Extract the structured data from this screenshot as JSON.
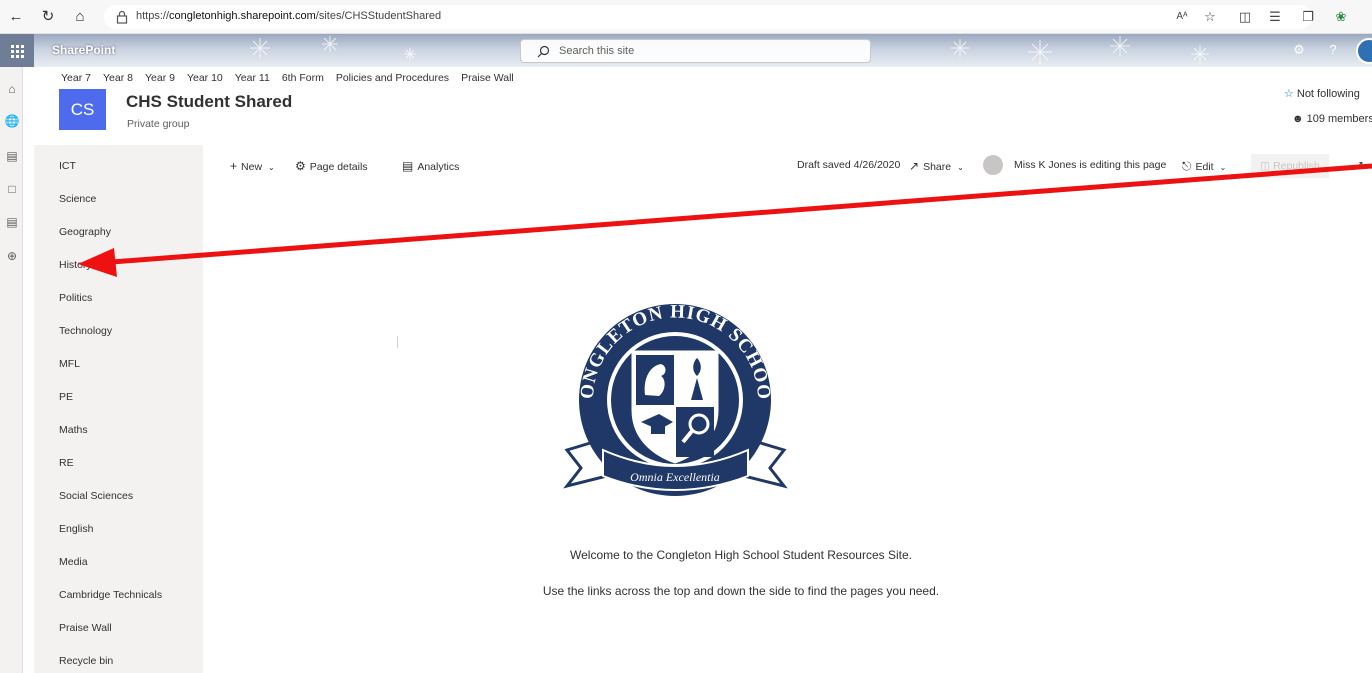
{
  "browser": {
    "url_prefix": "https://",
    "url_host": "congletonhigh.sharepoint.com",
    "url_path": "/sites/CHSStudentShared",
    "read_aloud_label": "Aᴬ"
  },
  "suite": {
    "app_name": "SharePoint",
    "search_placeholder": "Search this site",
    "help_label": "?"
  },
  "site": {
    "hub_links": [
      "Year 7",
      "Year 8",
      "Year 9",
      "Year 10",
      "Year 11",
      "6th Form",
      "Policies and Procedures",
      "Praise Wall"
    ],
    "logo_initials": "CS",
    "title": "CHS Student Shared",
    "subtitle": "Private group",
    "follow_label": "Not following",
    "members_label": "109 members"
  },
  "left_nav": {
    "items": [
      "ICT",
      "Science",
      "Geography",
      "History",
      "Politics",
      "Technology",
      "MFL",
      "PE",
      "Maths",
      "RE",
      "Social Sciences",
      "English",
      "Media",
      "Cambridge Technicals",
      "Praise Wall",
      "Recycle bin"
    ]
  },
  "command_bar": {
    "new_label": "New",
    "page_details_label": "Page details",
    "analytics_label": "Analytics",
    "draft_status": "Draft saved 4/26/2020",
    "share_label": "Share",
    "editing_status": "Miss K Jones is editing this page",
    "edit_label": "Edit",
    "republish_label": "Republish"
  },
  "content": {
    "crest_top_text": "CONGLETON HIGH SCHOOL",
    "crest_motto": "Omnia Excellentia",
    "welcome": "Welcome to the Congleton High School Student Resources Site.",
    "instructions": "Use the links across the top and down the side to find the pages you need."
  },
  "colors": {
    "site_logo": "#4f6bed",
    "crest_navy": "#1f3868",
    "annotation_arrow": "#ee1111"
  }
}
